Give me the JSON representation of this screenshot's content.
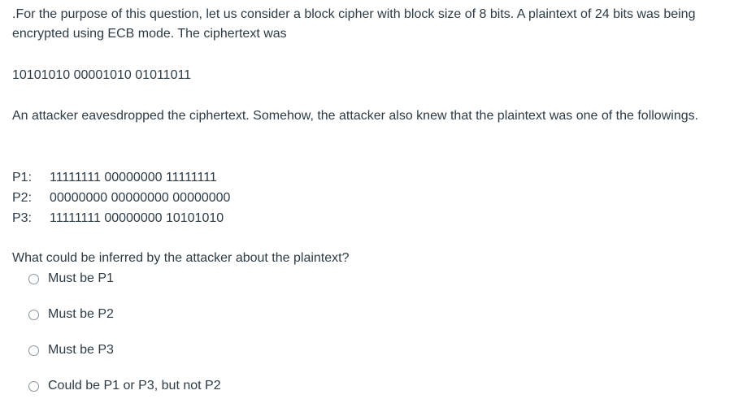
{
  "question": {
    "intro": ".For the purpose of this question, let us consider a block cipher with block size of 8 bits. A plaintext of 24 bits was being encrypted using ECB mode. The ciphertext was",
    "ciphertext": "10101010 00001010 01011011",
    "context": "An attacker eavesdropped the ciphertext. Somehow, the attacker also knew that the plaintext was one of the followings.",
    "candidates": [
      {
        "label": "P1:",
        "value": "11111111 00000000 11111111"
      },
      {
        "label": "P2:",
        "value": "00000000 00000000 00000000"
      },
      {
        "label": "P3:",
        "value": "11111111 00000000 10101010"
      }
    ],
    "prompt": "What could be inferred by the attacker about the plaintext?",
    "answers": [
      {
        "label": "Must be P1",
        "selected": false
      },
      {
        "label": "Must be P2",
        "selected": false
      },
      {
        "label": "Must be P3",
        "selected": false
      },
      {
        "label": "Could be P1 or P3, but not P2",
        "selected": false
      }
    ]
  }
}
